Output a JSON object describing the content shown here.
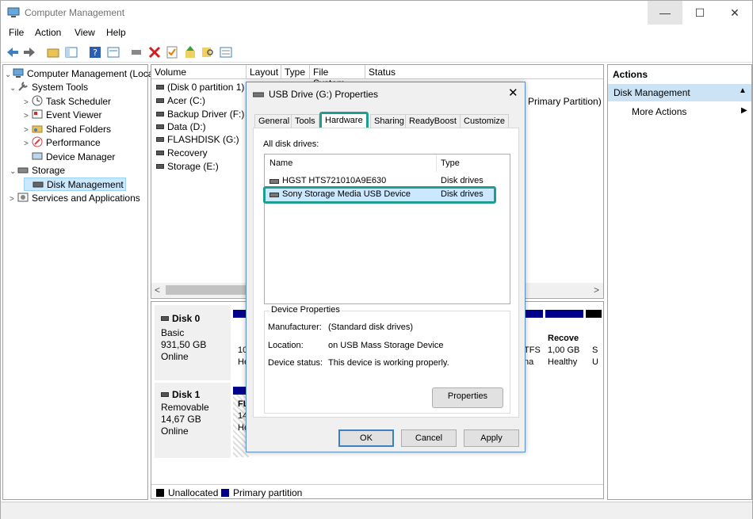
{
  "window": {
    "title": "Computer Management"
  },
  "menu": [
    "File",
    "Action",
    "View",
    "Help"
  ],
  "tree": {
    "root": "Computer Management (Local",
    "system_tools": "System Tools",
    "task_scheduler": "Task Scheduler",
    "event_viewer": "Event Viewer",
    "shared_folders": "Shared Folders",
    "performance": "Performance",
    "device_manager": "Device Manager",
    "storage": "Storage",
    "disk_management": "Disk Management",
    "services": "Services and Applications"
  },
  "volume_list": {
    "headers": [
      "Volume",
      "Layout",
      "Type",
      "File System",
      "Status"
    ],
    "volumes": [
      "(Disk 0 partition 1)",
      "Acer (C:)",
      "Backup Driver (F:)",
      "Data (D:)",
      "FLASHDISK (G:)",
      "Recovery",
      "Storage (E:)"
    ],
    "status_fragment": "Primary Partition)"
  },
  "disks": [
    {
      "name": "Disk 0",
      "kind": "Basic",
      "size": "931,50 GB",
      "state": "Online"
    },
    {
      "name": "Disk 1",
      "kind": "Removable",
      "size": "14,67 GB",
      "state": "Online"
    }
  ],
  "disk0_fragments": {
    "a1": "10",
    "a2": "He",
    "fs": "TFS",
    "fs2": "na",
    "rec_name": "Recove",
    "rec_size": "1,00 GB",
    "rec_health": "Healthy",
    "s1": "S",
    "s2": "U"
  },
  "disk1_fragments": {
    "b1": "FL",
    "b2": "14",
    "b3": "He"
  },
  "legend": {
    "unallocated": "Unallocated",
    "primary": "Primary partition"
  },
  "actions": {
    "header": "Actions",
    "section": "Disk Management",
    "more": "More Actions"
  },
  "dialog": {
    "title": "USB Drive (G:) Properties",
    "tabs": [
      "General",
      "Tools",
      "Hardware",
      "Sharing",
      "ReadyBoost",
      "Customize"
    ],
    "all_drives_label": "All disk drives:",
    "col_name": "Name",
    "col_type": "Type",
    "drives": [
      {
        "name": "HGST HTS721010A9E630",
        "type": "Disk drives"
      },
      {
        "name": "Sony Storage Media USB Device",
        "type": "Disk drives"
      }
    ],
    "device_properties": "Device Properties",
    "manufacturer_label": "Manufacturer:",
    "manufacturer": "(Standard disk drives)",
    "location_label": "Location:",
    "location": "on USB Mass Storage Device",
    "status_label": "Device status:",
    "status": "This device is working properly.",
    "properties_btn": "Properties",
    "ok": "OK",
    "cancel": "Cancel",
    "apply": "Apply"
  },
  "colors": {
    "accent": "#1f9d8f",
    "primary_partition": "#00008b",
    "selection": "#cce8ff"
  }
}
